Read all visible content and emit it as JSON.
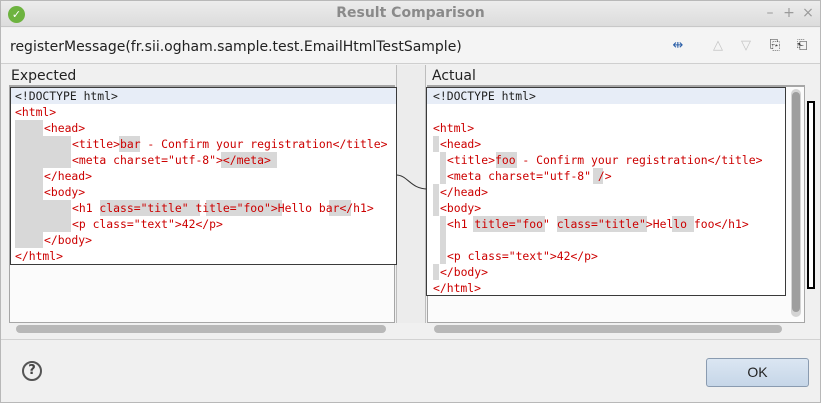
{
  "window": {
    "title": "Result Comparison",
    "minimize_glyph": "–",
    "maximize_glyph": "+",
    "close_glyph": "×",
    "app_icon": "spring-leaf-icon",
    "app_icon_glyph": "✓"
  },
  "header": {
    "title": "registerMessage(fr.sii.ogham.sample.test.EmailHtmlTestSample)",
    "toolbar": [
      {
        "name": "swap-sides-icon",
        "glyph": "⇹",
        "enabled": true
      },
      {
        "name": "previous-difference-icon",
        "glyph": "△",
        "enabled": false
      },
      {
        "name": "next-difference-icon",
        "glyph": "▽",
        "enabled": false
      },
      {
        "name": "copy-left-icon",
        "glyph": "⎘",
        "enabled": true
      },
      {
        "name": "copy-right-icon",
        "glyph": "⎗",
        "enabled": true
      }
    ]
  },
  "expected": {
    "label": "Expected",
    "lines": [
      "<!DOCTYPE html>",
      "<html>",
      "<head>",
      "<title>bar - Confirm your registration</title>",
      "<meta charset=\"utf-8\"></meta>",
      "</head>",
      "<body>",
      "<h1 class=\"title\" title=\"foo\">Hello bar</h1>",
      "<p class=\"text\">42</p>",
      "</body>",
      "</html>"
    ]
  },
  "actual": {
    "label": "Actual",
    "lines": [
      "<!DOCTYPE html>",
      "",
      "<html>",
      "<head>",
      "<title>foo - Confirm your registration</title>",
      "<meta charset=\"utf-8\" />",
      "</head>",
      "<body>",
      "<h1 title=\"foo\" class=\"title\">Hello foo</h1>",
      "",
      "<p class=\"text\">42</p>",
      "</body>",
      "</html>"
    ]
  },
  "footer": {
    "help_glyph": "?",
    "ok_label": "OK"
  },
  "colors": {
    "code_text": "#cc0000",
    "diff_highlight": "#d8d8d8",
    "first_line_bg": "#e7edf7",
    "ok_button": "#c6d6e8"
  }
}
